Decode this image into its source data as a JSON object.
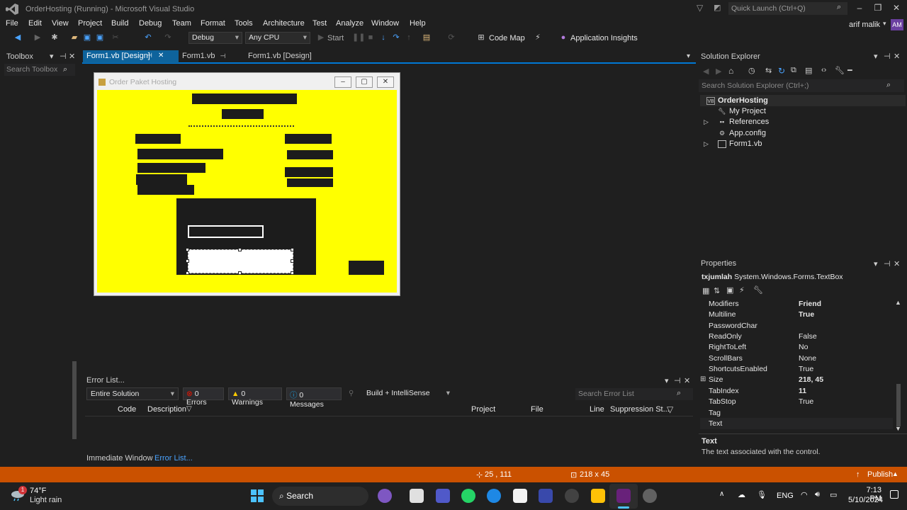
{
  "window": {
    "title": "OrderHosting (Running) - Microsoft Visual Studio",
    "quick_launch_placeholder": "Quick Launch (Ctrl+Q)",
    "user_name": "arif malik",
    "user_initials": "AM"
  },
  "menu": [
    "File",
    "Edit",
    "View",
    "Project",
    "Build",
    "Debug",
    "Team",
    "Format",
    "Tools",
    "Architecture",
    "Test",
    "Analyze",
    "Window",
    "Help"
  ],
  "toolbar": {
    "config": "Debug",
    "platform": "Any CPU",
    "start_label": "Start",
    "code_map_label": "Code Map",
    "app_insights_label": "Application Insights"
  },
  "toolbox": {
    "title": "Toolbox",
    "search_placeholder": "Search Toolbox"
  },
  "doc_tabs": [
    "Form1.vb [Design]",
    "Form1.vb",
    "Form1.vb [Design]"
  ],
  "designer": {
    "form_title": "Order Paket Hosting"
  },
  "error_list": {
    "title": "Error List...",
    "scope": "Entire Solution",
    "errors": "0 Errors",
    "warnings": "0 Warnings",
    "messages": "0 Messages",
    "build_filter": "Build + IntelliSense",
    "search_placeholder": "Search Error List",
    "columns": [
      "Code",
      "Description",
      "Project",
      "File",
      "Line",
      "Suppression St..."
    ]
  },
  "bottom_tabs": [
    "Immediate Window",
    "Error List..."
  ],
  "solution_explorer": {
    "title": "Solution Explorer",
    "search_placeholder": "Search Solution Explorer (Ctrl+;)",
    "items": [
      "OrderHosting",
      "My Project",
      "References",
      "App.config",
      "Form1.vb"
    ]
  },
  "properties": {
    "title": "Properties",
    "object_name": "txjumlah",
    "object_type": "System.Windows.Forms.TextBox",
    "rows": [
      {
        "name": "Modifiers",
        "value": "Friend"
      },
      {
        "name": "Multiline",
        "value": "True"
      },
      {
        "name": "PasswordChar",
        "value": ""
      },
      {
        "name": "ReadOnly",
        "value": "False"
      },
      {
        "name": "RightToLeft",
        "value": "No"
      },
      {
        "name": "ScrollBars",
        "value": "None"
      },
      {
        "name": "ShortcutsEnabled",
        "value": "True"
      },
      {
        "name": "Size",
        "value": "218, 45"
      },
      {
        "name": "TabIndex",
        "value": "11"
      },
      {
        "name": "TabStop",
        "value": "True"
      },
      {
        "name": "Tag",
        "value": ""
      },
      {
        "name": "Text",
        "value": ""
      }
    ],
    "desc_title": "Text",
    "desc_text": "The text associated with the control."
  },
  "status_bar": {
    "position": "25 , 111",
    "size": "218 x 45",
    "publish": "Publish"
  },
  "taskbar": {
    "temperature": "74°F",
    "weather": "Light rain",
    "weather_badge": "1",
    "search_label": "Search",
    "language": "ENG",
    "time": "7:13 PM",
    "date": "5/10/2024"
  }
}
